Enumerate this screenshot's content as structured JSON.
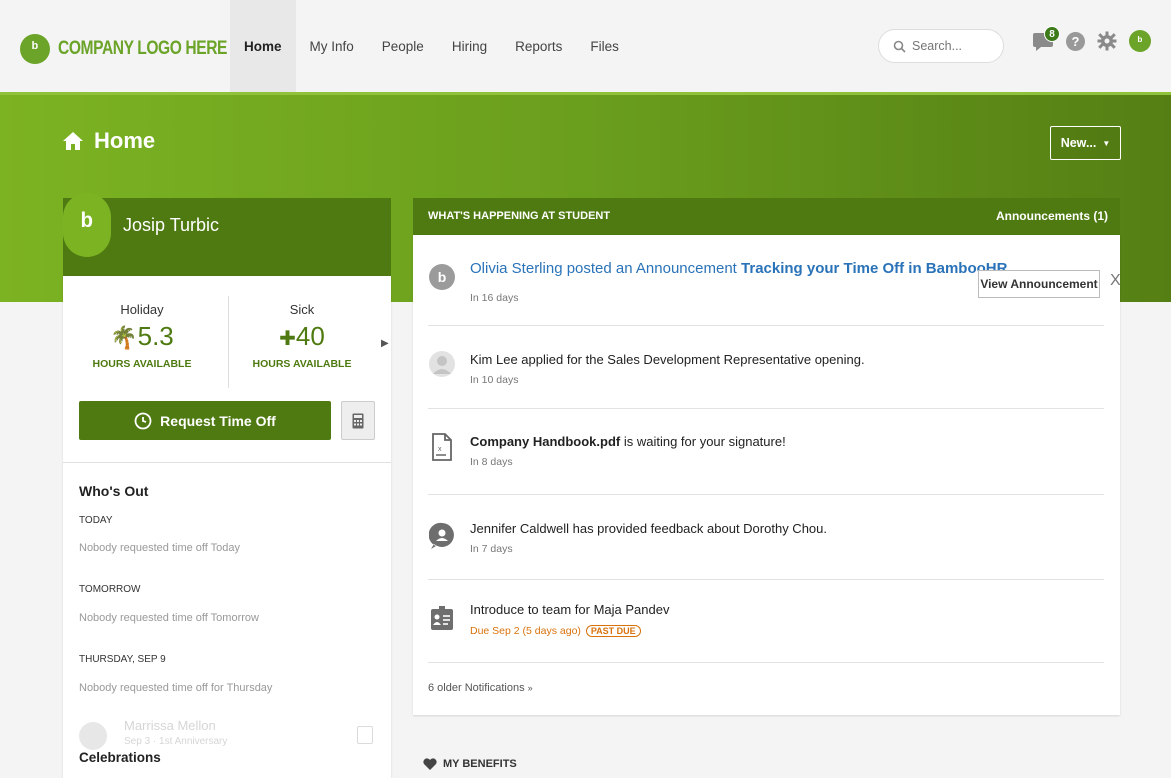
{
  "nav": {
    "logo_text": "COMPANY LOGO HERE",
    "tabs": [
      "Home",
      "My Info",
      "People",
      "Hiring",
      "Reports",
      "Files"
    ],
    "active_tab": "Home",
    "search_placeholder": "Search...",
    "notification_count": "8",
    "help_glyph": "?",
    "accent_color": "#6ba428"
  },
  "page": {
    "title": "Home",
    "new_button": "New..."
  },
  "profile": {
    "name": "Josip Turbic",
    "balances": [
      {
        "label": "Holiday",
        "value": "5.3",
        "unit": "HOURS AVAILABLE",
        "icon": "palm-tree-icon"
      },
      {
        "label": "Sick",
        "value": "40",
        "unit": "HOURS AVAILABLE",
        "icon": "bandage-icon"
      }
    ],
    "request_button": "Request Time Off"
  },
  "whos_out": {
    "title": "Who's Out",
    "days": [
      {
        "label": "TODAY",
        "text": "Nobody requested time off Today"
      },
      {
        "label": "TOMORROW",
        "text": "Nobody requested time off Tomorrow"
      },
      {
        "label": "THURSDAY, SEP 9",
        "text": "Nobody requested time off for Thursday"
      }
    ],
    "ghost_name": "Marrissa Mellon",
    "ghost_sub": "Sep 3 · 1st Anniversary",
    "celebrations_title": "Celebrations"
  },
  "feed": {
    "title": "WHAT'S HAPPENING AT STUDENT",
    "announcements": "Announcements (1)",
    "items": [
      {
        "text_a": "Olivia Sterling posted an Announcement ",
        "text_b": "Tracking your Time Off in BambooHR",
        "sub": "In 16 days",
        "button": "View Announcement",
        "close": "X"
      },
      {
        "text": "Kim Lee applied for the Sales Development Representative opening.",
        "sub": "In 10 days"
      },
      {
        "text_bold": "Company Handbook.pdf",
        "text": " is waiting for your signature!",
        "sub": "In 8 days"
      },
      {
        "text": "Jennifer Caldwell has provided feedback about Dorothy Chou.",
        "sub": "In 7 days"
      },
      {
        "text": "Introduce to team for Maja Pandev",
        "due": "Due Sep 2 (5 days ago)",
        "badge": "PAST DUE"
      }
    ],
    "older": "6 older Notifications"
  },
  "benefits": {
    "title": "MY BENEFITS"
  }
}
